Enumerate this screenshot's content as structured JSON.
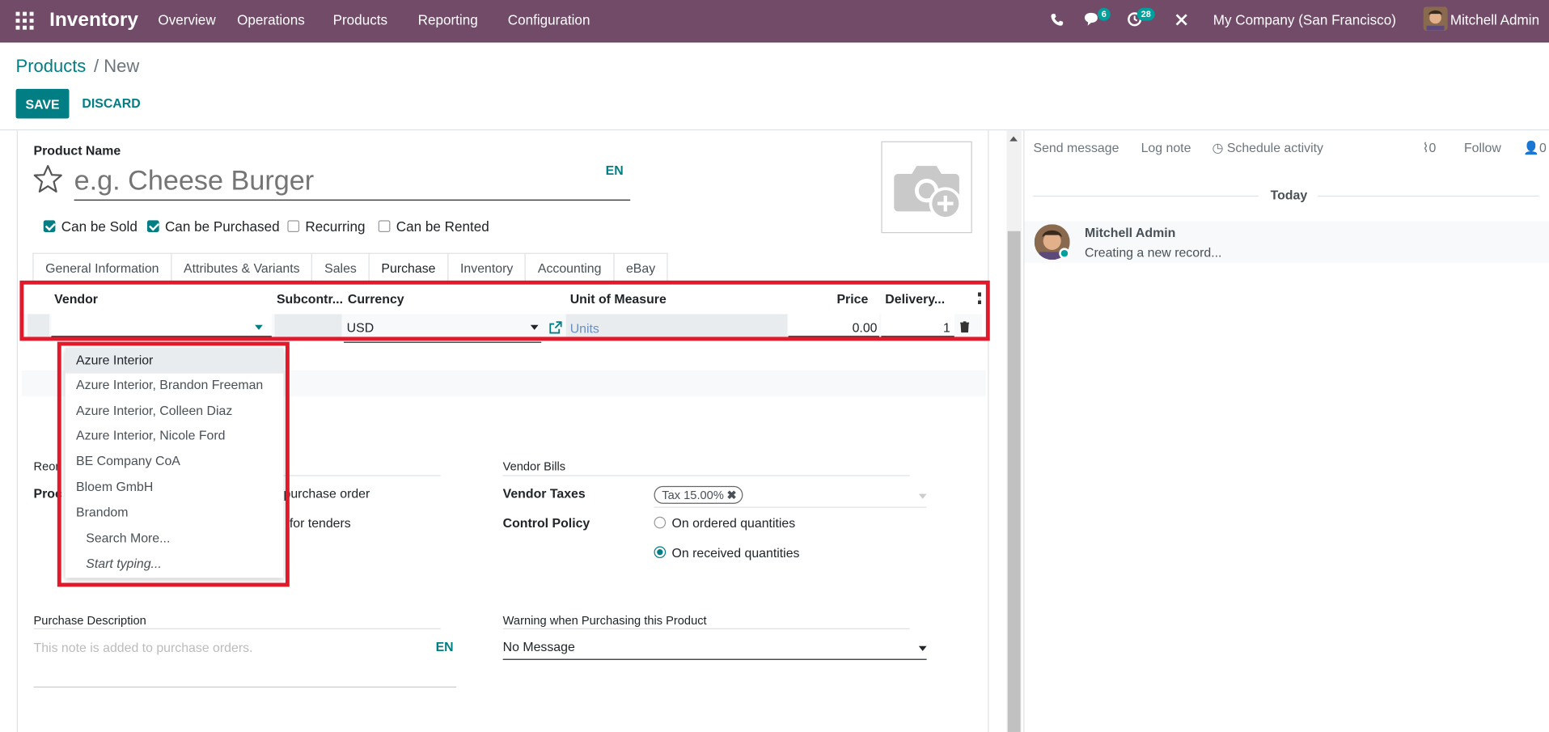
{
  "navbar": {
    "app_name": "Inventory",
    "menu": [
      "Overview",
      "Operations",
      "Products",
      "Reporting",
      "Configuration"
    ],
    "messages_count": "6",
    "activities_count": "28",
    "company": "My Company (San Francisco)",
    "user": "Mitchell Admin"
  },
  "breadcrumb": {
    "parent": "Products",
    "separator": "/",
    "current": "New"
  },
  "buttons": {
    "save": "SAVE",
    "discard": "DISCARD"
  },
  "form": {
    "product_name_label": "Product Name",
    "product_name_placeholder": "e.g. Cheese Burger",
    "lang": "EN",
    "checkboxes": [
      {
        "label": "Can be Sold",
        "checked": true
      },
      {
        "label": "Can be Purchased",
        "checked": true
      },
      {
        "label": "Recurring",
        "checked": false
      },
      {
        "label": "Can be Rented",
        "checked": false
      }
    ],
    "tabs": [
      "General Information",
      "Attributes & Variants",
      "Sales",
      "Purchase",
      "Inventory",
      "Accounting",
      "eBay"
    ],
    "active_tab": "Purchase",
    "vendor_table": {
      "headers": [
        "Vendor",
        "Subcontr...",
        "Currency",
        "Unit of Measure",
        "Price",
        "Delivery..."
      ],
      "row": {
        "vendor": "",
        "currency": "USD",
        "uom": "Units",
        "price": "0.00",
        "delivery": "1"
      }
    },
    "vendor_dropdown": {
      "options": [
        "Azure Interior",
        "Azure Interior, Brandon Freeman",
        "Azure Interior, Colleen Diaz",
        "Azure Interior, Nicole Ford",
        "BE Company CoA",
        "Bloem GmbH",
        "Brandom"
      ],
      "search_more": "Search More...",
      "start_typing": "Start typing..."
    },
    "reordering": {
      "section_label_fragment": "Reor",
      "field_label_fragment": "Proc",
      "option1_fragment": "purchase order",
      "option2_fragment": "for tenders"
    },
    "vendor_bills": {
      "section_label": "Vendor Bills",
      "taxes_label": "Vendor Taxes",
      "tax_tag": "Tax 15.00%",
      "control_policy_label": "Control Policy",
      "policies": [
        {
          "label": "On ordered quantities",
          "selected": false
        },
        {
          "label": "On received quantities",
          "selected": true
        }
      ]
    },
    "purchase_description": {
      "label": "Purchase Description",
      "placeholder": "This note is added to purchase orders.",
      "lang": "EN"
    },
    "purchase_warning": {
      "label": "Warning when Purchasing this Product",
      "value": "No Message"
    }
  },
  "chatter": {
    "send_message": "Send message",
    "log_note": "Log note",
    "schedule_activity": "Schedule activity",
    "attachments": "0",
    "follow": "Follow",
    "followers": "0",
    "date_separator": "Today",
    "message": {
      "author": "Mitchell Admin",
      "body": "Creating a new record..."
    }
  },
  "colors": {
    "navbar": "#714b67",
    "primary": "#017e84",
    "highlight": "#e2182b"
  }
}
